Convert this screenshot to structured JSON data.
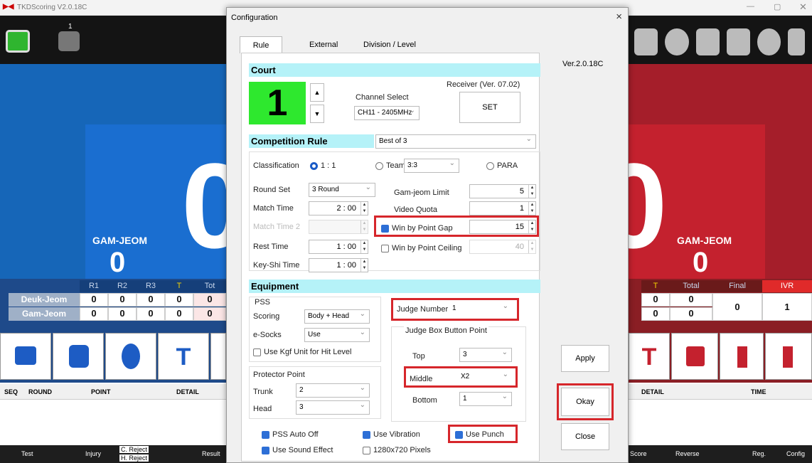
{
  "app": {
    "title": "TKDScoring V2.0.18C",
    "receiver_count": "1"
  },
  "blue": {
    "score": "0",
    "gamjeom_label": "GAM-JEOM",
    "gamjeom_value": "0"
  },
  "red": {
    "score": "0",
    "gamjeom_label": "GAM-JEOM",
    "gamjeom_value": "0"
  },
  "blue_table": {
    "headers": [
      "R1",
      "R2",
      "R3",
      "T",
      "Tot"
    ],
    "rows": [
      {
        "label": "Deuk-Jeom",
        "values": [
          "0",
          "0",
          "0",
          "0",
          "0"
        ]
      },
      {
        "label": "Gam-Jeom",
        "values": [
          "0",
          "0",
          "0",
          "0",
          "0"
        ]
      }
    ]
  },
  "red_table": {
    "headers": [
      "T",
      "Total",
      "Final",
      "IVR"
    ],
    "rows": [
      [
        "0",
        "0"
      ],
      [
        "0",
        "0"
      ]
    ],
    "final": "0",
    "ivr": "1"
  },
  "log": {
    "headers_left": [
      "SEQ",
      "ROUND",
      "POINT",
      "DETAIL"
    ],
    "headers_right": [
      "DETAIL",
      "TIME"
    ]
  },
  "toolbar": {
    "test": "Test",
    "injury": "Injury",
    "c_reject": "C. Reject",
    "h_reject": "H. Reject",
    "result": "Result",
    "score": "Score",
    "reverse": "Reverse",
    "reg": "Reg.",
    "config": "Config"
  },
  "dialog": {
    "title": "Configuration",
    "close": "×",
    "version": "Ver.2.0.18C",
    "tabs": [
      "Rule",
      "External",
      "Division / Level"
    ],
    "court": {
      "section": "Court",
      "number": "1",
      "channel_label": "Channel Select",
      "channel_value": "CH11 - 2405MHz",
      "receiver_label": "Receiver (Ver. 07.02)",
      "set_button": "SET"
    },
    "competition": {
      "section": "Competition Rule",
      "best_of": "Best of 3",
      "classification_label": "Classification",
      "class_opt1": "1 : 1",
      "class_opt2": "Team",
      "team_value": "3:3",
      "class_opt3": "PARA",
      "round_set_label": "Round Set",
      "round_set_value": "3 Round",
      "match_time_label": "Match Time",
      "match_time_value": "2 : 00",
      "match_time2_label": "Match Time 2",
      "match_time2_value": "",
      "rest_time_label": "Rest Time",
      "rest_time_value": "1 : 00",
      "keyshi_label": "Key-Shi Time",
      "keyshi_value": "1 : 00",
      "gamjeom_limit_label": "Gam-jeom Limit",
      "gamjeom_limit_value": "5",
      "video_quota_label": "Video Quota",
      "video_quota_value": "1",
      "point_gap_label": "Win by Point Gap",
      "point_gap_value": "15",
      "point_ceiling_label": "Win by Point Ceiling",
      "point_ceiling_value": "40"
    },
    "equipment": {
      "section": "Equipment",
      "pss_label": "PSS",
      "scoring_label": "Scoring",
      "scoring_value": "Body + Head",
      "esocks_label": "e-Socks",
      "esocks_value": "Use",
      "kgf_label": "Use Kgf Unit for Hit Level",
      "protector_label": "Protector Point",
      "trunk_label": "Trunk",
      "trunk_value": "2",
      "head_label": "Head",
      "head_value": "3",
      "judge_number_label": "Judge Number",
      "judge_number_value": "1",
      "judge_box_label": "Judge Box Button Point",
      "top_label": "Top",
      "top_value": "3",
      "middle_label": "Middle",
      "middle_value": "X2",
      "bottom_label": "Bottom",
      "bottom_value": "1"
    },
    "options": {
      "pss_auto_off": "PSS Auto Off",
      "use_vibration": "Use Vibration",
      "use_punch": "Use Punch",
      "use_sound": "Use Sound Effect",
      "pixels": "1280x720 Pixels"
    },
    "buttons": {
      "apply": "Apply",
      "okay": "Okay",
      "close": "Close"
    }
  },
  "colors": {
    "highlight": "#d6262b",
    "section": "#b5f2f8",
    "court_bg": "#2ee82e",
    "blue": "#1a6ed0",
    "red": "#c4212e"
  }
}
